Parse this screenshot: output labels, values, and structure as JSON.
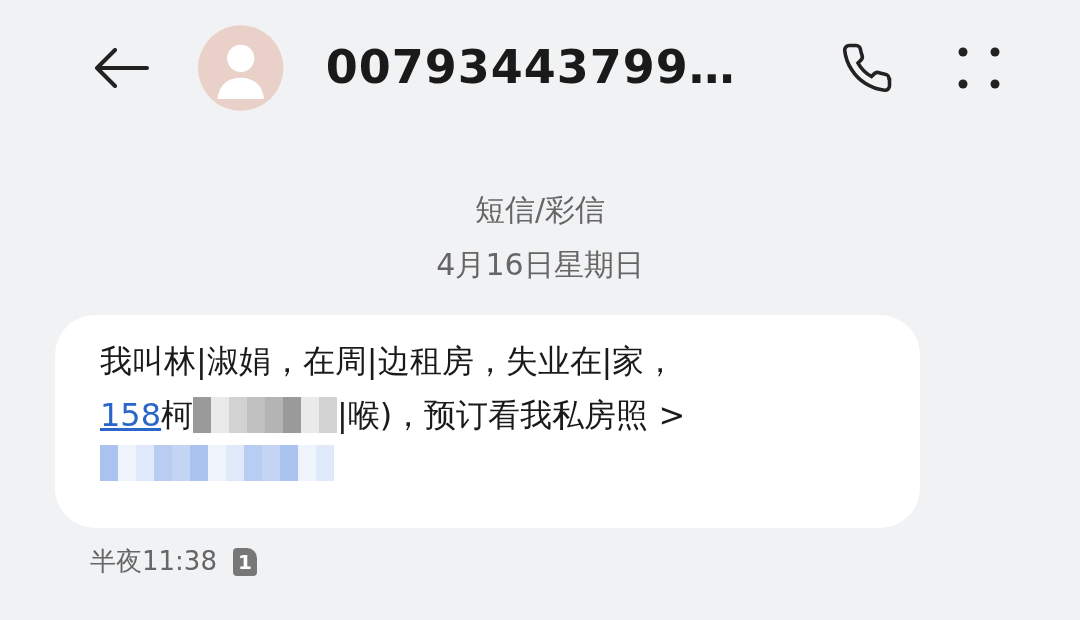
{
  "header": {
    "title": "00793443799…"
  },
  "thread": {
    "channel": "短信/彩信",
    "date": "4月16日星期日"
  },
  "message": {
    "line_1": "我叫林|淑娟，在周|边租房，失业在|家，",
    "number_link": "158",
    "text_before_censor": "柯",
    "text_after_censor": "|喉)，预订看我私房照 >",
    "time": "半夜11:38",
    "sim_badge": "1"
  }
}
